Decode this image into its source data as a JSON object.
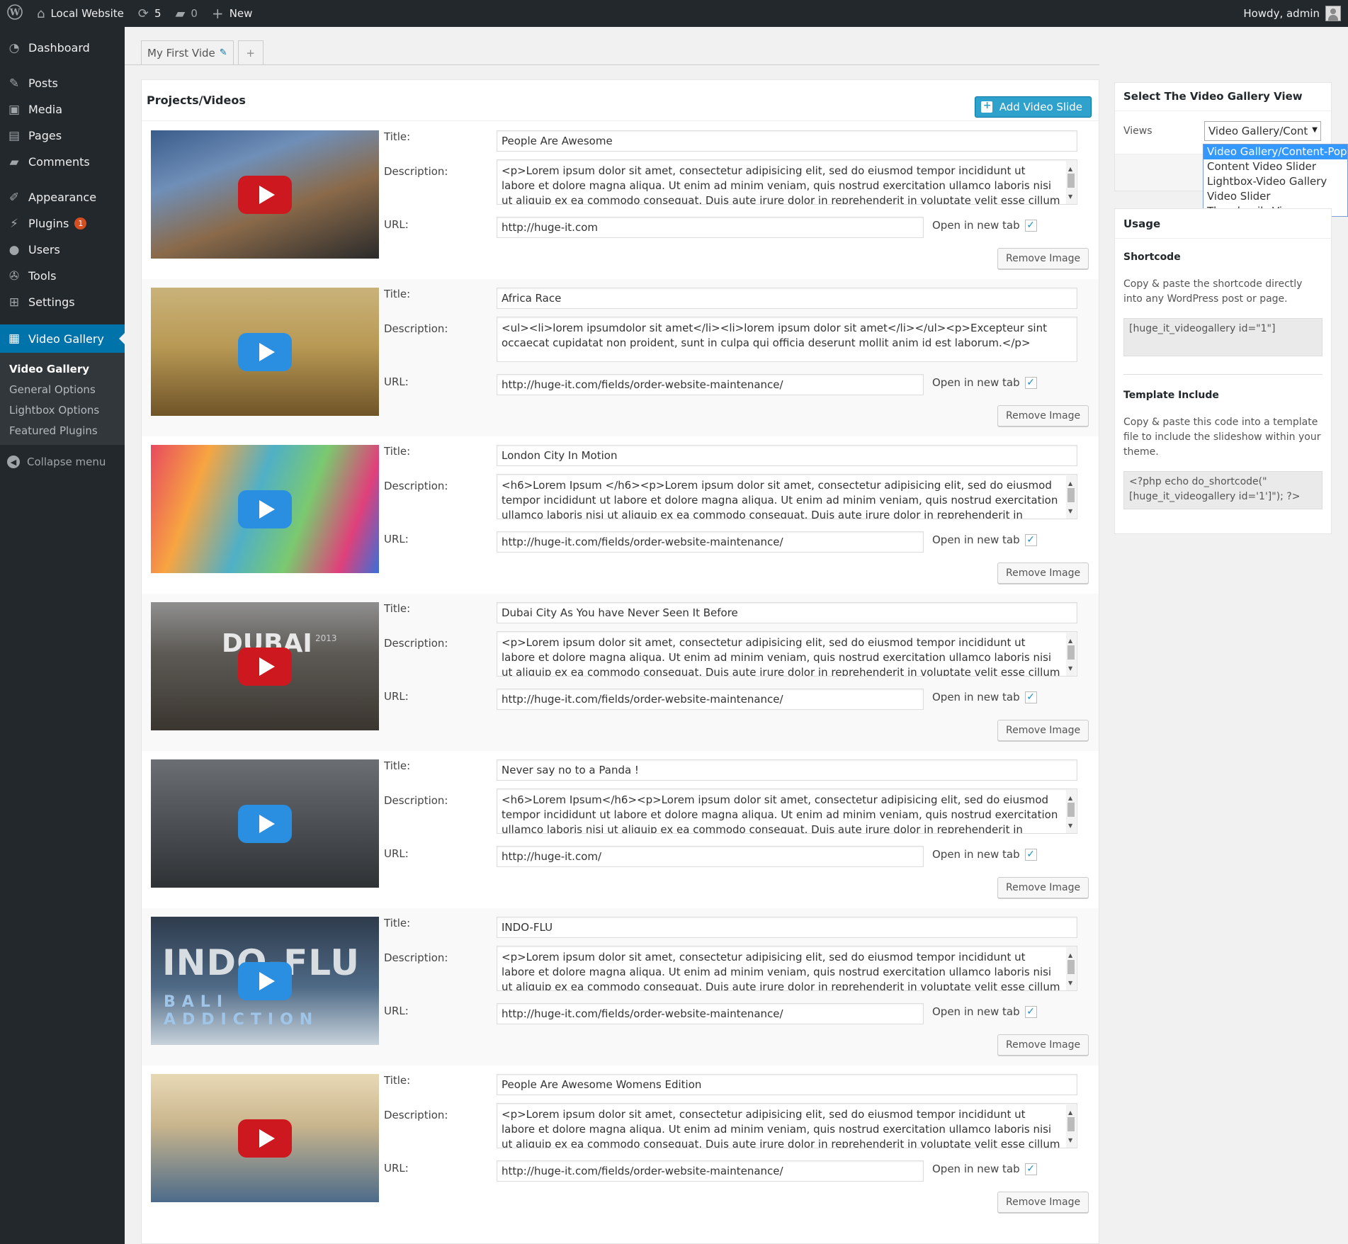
{
  "adminbar": {
    "site_name": "Local Website",
    "updates_count": "5",
    "comments_count": "0",
    "new_label": "New",
    "howdy": "Howdy, admin"
  },
  "sidebar": {
    "items": [
      {
        "label": "Dashboard",
        "icon": "dashboard-icon"
      },
      {
        "label": "Posts",
        "icon": "pin-icon"
      },
      {
        "label": "Media",
        "icon": "media-icon"
      },
      {
        "label": "Pages",
        "icon": "pages-icon"
      },
      {
        "label": "Comments",
        "icon": "comment-icon"
      },
      {
        "label": "Appearance",
        "icon": "brush-icon"
      },
      {
        "label": "Plugins",
        "icon": "plugin-icon",
        "badge": "1"
      },
      {
        "label": "Users",
        "icon": "users-icon"
      },
      {
        "label": "Tools",
        "icon": "wrench-icon"
      },
      {
        "label": "Settings",
        "icon": "settings-icon"
      },
      {
        "label": "Video Gallery",
        "icon": "video-icon"
      }
    ],
    "submenu": [
      "Video Gallery",
      "General Options",
      "Lightbox Options",
      "Featured Plugins"
    ],
    "collapse": "Collapse menu"
  },
  "tabs": {
    "gallery_name": "My First Vide",
    "add": "+"
  },
  "main": {
    "heading": "Projects/Videos",
    "add_button": "Add Video Slide",
    "labels": {
      "title": "Title:",
      "description": "Description:",
      "url": "URL:",
      "new_tab": "Open in new tab",
      "remove": "Remove Image"
    },
    "videos": [
      {
        "title": "People Are Awesome",
        "description": "<p>Lorem ipsum dolor sit amet, consectetur adipisicing elit, sed do eiusmod tempor incididunt ut labore et dolore magna aliqua. Ut enim ad minim veniam, quis nostrud exercitation ullamco laboris nisi ut aliquip ex ea commodo consequat. Duis aute irure dolor in reprehenderit in voluptate velit esse cillum dolore eu fugiat",
        "url": "http://huge-it.com",
        "play": "red",
        "scroll": true
      },
      {
        "title": "Africa Race",
        "description": "<ul><li>lorem ipsumdolor sit amet</li><li>lorem ipsum dolor sit amet</li></ul><p>Excepteur sint occaecat cupidatat non proident, sunt in culpa qui officia deserunt mollit anim id est laborum.</p>",
        "url": "http://huge-it.com/fields/order-website-maintenance/",
        "play": "blue",
        "scroll": false
      },
      {
        "title": "London City In Motion",
        "description": "<h6>Lorem Ipsum </h6><p>Lorem ipsum dolor sit amet, consectetur adipisicing elit, sed do eiusmod tempor incididunt ut labore et dolore magna aliqua. Ut enim ad minim veniam, quis nostrud exercitation ullamco laboris nisi ut aliquip ex ea commodo consequat. Duis aute irure dolor in reprehenderit in voluptate velit esse",
        "url": "http://huge-it.com/fields/order-website-maintenance/",
        "play": "blue",
        "scroll": true
      },
      {
        "title": "Dubai City As You have Never Seen It Before",
        "description": "<p>Lorem ipsum dolor sit amet, consectetur adipisicing elit, sed do eiusmod tempor incididunt ut labore et dolore magna aliqua. Ut enim ad minim veniam, quis nostrud exercitation ullamco laboris nisi ut aliquip ex ea commodo consequat. Duis aute irure dolor in reprehenderit in voluptate velit esse cillum dolore eu fugiat",
        "url": "http://huge-it.com/fields/order-website-maintenance/",
        "play": "red",
        "scroll": true,
        "thumb_text": "DUBAI",
        "thumb_year": "2013"
      },
      {
        "title": "Never say no to a Panda !",
        "description": "<h6>Lorem Ipsum</h6><p>Lorem ipsum dolor sit amet, consectetur adipisicing elit, sed do eiusmod tempor incididunt ut labore et dolore magna aliqua. Ut enim ad minim veniam, quis nostrud exercitation ullamco laboris nisi ut aliquip ex ea commodo consequat. Duis aute irure dolor in reprehenderit in voluptate velit esse",
        "url": "http://huge-it.com/",
        "play": "blue",
        "scroll": true
      },
      {
        "title": "INDO-FLU",
        "description": "<p>Lorem ipsum dolor sit amet, consectetur adipisicing elit, sed do eiusmod tempor incididunt ut labore et dolore magna aliqua. Ut enim ad minim veniam, quis nostrud exercitation ullamco laboris nisi ut aliquip ex ea commodo consequat. Duis aute irure dolor in reprehenderit in voluptate velit esse cillum dolore eu fugiat",
        "url": "http://huge-it.com/fields/order-website-maintenance/",
        "play": "blue",
        "scroll": true,
        "thumb_text": "INDO-FLU",
        "thumb_sub": "BALI ADDICTION"
      },
      {
        "title": "People Are Awesome Womens Edition",
        "description": "<p>Lorem ipsum dolor sit amet, consectetur adipisicing elit, sed do eiusmod tempor incididunt ut labore et dolore magna aliqua. Ut enim ad minim veniam, quis nostrud exercitation ullamco laboris nisi ut aliquip ex ea commodo consequat. Duis aute irure dolor in reprehenderit in voluptate velit esse cillum dolore eu fugiat",
        "url": "http://huge-it.com/fields/order-website-maintenance/",
        "play": "red",
        "scroll": true
      }
    ]
  },
  "views": {
    "heading": "Select The Video Gallery View",
    "label": "Views",
    "selected": "Video Gallery/Cont",
    "options": [
      "Video Gallery/Content-Popup",
      "Content Video Slider",
      "Lightbox-Video Gallery",
      "Video Slider",
      "Thumbnails View"
    ]
  },
  "usage": {
    "heading": "Usage",
    "shortcode_title": "Shortcode",
    "shortcode_text": "Copy & paste the shortcode directly into any WordPress post or page.",
    "shortcode_code": "[huge_it_videogallery id=\"1\"]",
    "template_title": "Template Include",
    "template_text": "Copy & paste this code into a template file to include the slideshow within your theme.",
    "template_code": "<?php echo do_shortcode(\"[huge_it_videogallery id='1']\"); ?>"
  },
  "colors": {
    "adminbar_bg": "#23282d",
    "accent": "#0073aa",
    "button_primary": "#2ea2cc",
    "youtube_red": "#cc181e",
    "play_blue": "#2a8fe0"
  }
}
